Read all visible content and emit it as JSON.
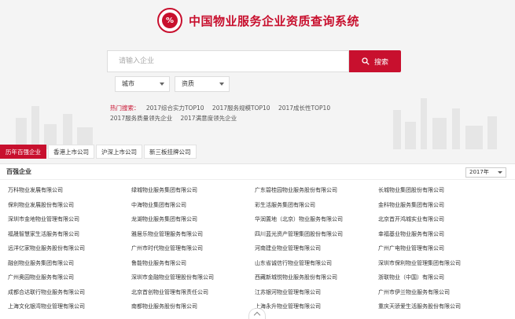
{
  "header": {
    "logo_text": "%",
    "title": "中国物业服务企业资质查询系统"
  },
  "search": {
    "placeholder": "请输入企业",
    "button_label": "搜索"
  },
  "filters": {
    "city": "城市",
    "qualification": "资质"
  },
  "hot_search": {
    "label": "热门搜索：",
    "links": [
      "2017综合实力TOP10",
      "2017服务规模TOP10",
      "2017成长性TOP10",
      "2017服务质量领先企业",
      "2017满意度领先企业"
    ]
  },
  "tabs": [
    "历年百强企业",
    "香港上市公司",
    "沪深上市公司",
    "新三板挂牌公司"
  ],
  "panel": {
    "title": "百强企业",
    "year": "2017年"
  },
  "companies": [
    "万科物业发展有限公司",
    "绿城物业服务集团有限公司",
    "广东碧桂园物业服务股份有限公司",
    "长城物业集团股份有限公司",
    "保利物业发展股份有限公司",
    "中海物业集团有限公司",
    "彩生活服务集团有限公司",
    "金科物业服务集团有限公司",
    "深圳市金地物业管理有限公司",
    "龙湖物业服务集团有限公司",
    "华润置地（北京）物业服务有限公司",
    "北京首开鸿城实业有限公司",
    "福晟智慧家生活服务有限公司",
    "雅居乐物业管理服务有限公司",
    "四川蓝光资产管理集团股份有限公司",
    "幸福基业物业服务有限公司",
    "远洋亿家物业服务股份有限公司",
    "广州市时代物业管理有限公司",
    "河南建业物业管理有限公司",
    "广州广电物业管理有限公司",
    "融创物业服务集团有限公司",
    "鲁能物业服务有限公司",
    "山东省诚信行物业管理有限公司",
    "深圳市保利物业管理集团有限公司",
    "广州奥园物业服务有限公司",
    "深圳市金融物业管理股份有限公司",
    "西藏新城悦物业服务股份有限公司",
    "浙联物业（中国）有限公司",
    "成都合达联行物业服务有限公司",
    "北京首创物业管理有限责任公司",
    "江苏银河物业管理有限公司",
    "广州市伊兰物业服务有限公司",
    "上海文化银湾物业管理有限公司",
    "南都物业服务股份有限公司",
    "上海永升物业管理有限公司",
    "重庆天骄爱生活服务股份有限公司"
  ],
  "colors": {
    "brand": "#c8102e",
    "background": "#f4f4f4"
  },
  "icons": {
    "search": "search-icon",
    "scroll_up": "chevron-up-icon",
    "logo": "seal-logo-icon"
  }
}
